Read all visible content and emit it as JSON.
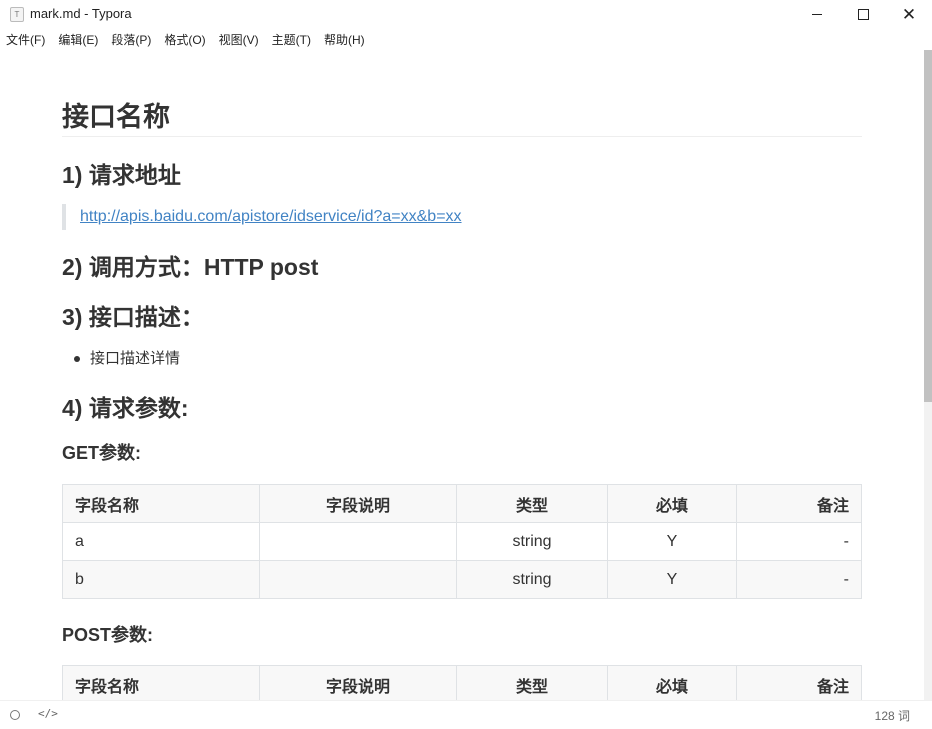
{
  "window": {
    "title": "mark.md - Typora",
    "app_icon_glyph": "T",
    "close_glyph": "✕"
  },
  "menu": [
    "文件(F)",
    "编辑(E)",
    "段落(P)",
    "格式(O)",
    "视图(V)",
    "主题(T)",
    "帮助(H)"
  ],
  "doc": {
    "h1": "接口名称",
    "h2_url": "1) 请求地址",
    "url": "http://apis.baidu.com/apistore/idservice/id?a=xx&b=xx",
    "h2_method": "2) 调用方式：HTTP post",
    "h2_desc": "3) 接口描述：",
    "bullet": "接口描述详情",
    "h2_params": "4) 请求参数:",
    "h3_get": "GET参数:",
    "h3_post": "POST参数:",
    "table_headers": [
      "字段名称",
      "字段说明",
      "类型",
      "必填",
      "备注"
    ],
    "get_rows": [
      [
        "a",
        "",
        "string",
        "Y",
        "-"
      ],
      [
        "b",
        "",
        "string",
        "Y",
        "-"
      ]
    ]
  },
  "status": {
    "code_icon": "</>",
    "word_count": "128 词"
  },
  "colors": {
    "link": "#4183c4",
    "text": "#333333",
    "table_border": "#dfe2e5"
  }
}
